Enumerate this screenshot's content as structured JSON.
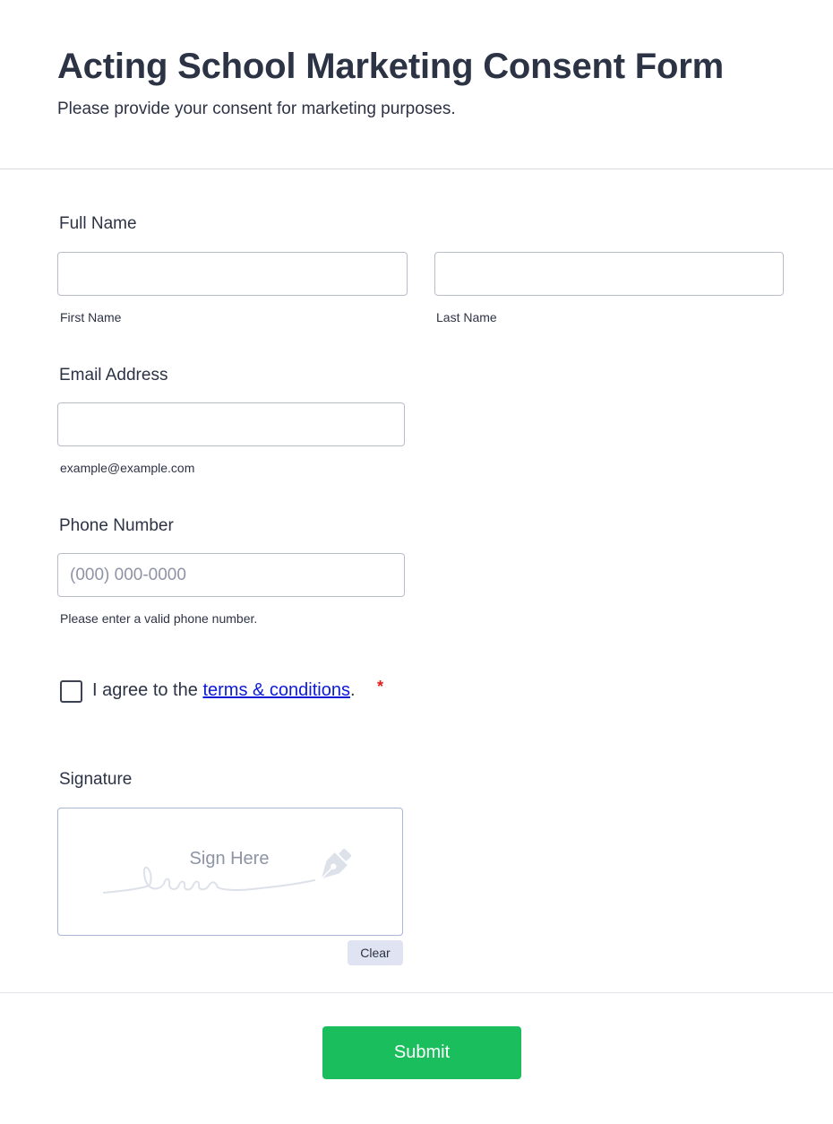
{
  "form": {
    "title": "Acting School Marketing Consent Form",
    "subtitle": "Please provide your consent for marketing purposes."
  },
  "full_name": {
    "label": "Full Name",
    "first": {
      "value": "",
      "sublabel": "First Name"
    },
    "last": {
      "value": "",
      "sublabel": "Last Name"
    }
  },
  "email": {
    "label": "Email Address",
    "value": "",
    "sublabel": "example@example.com"
  },
  "phone": {
    "label": "Phone Number",
    "value": "",
    "placeholder": "(000) 000-0000",
    "sublabel": "Please enter a valid phone number."
  },
  "terms": {
    "prefix": "I agree to the",
    "link_text": "terms & conditions",
    "suffix": ".",
    "required_mark": "*",
    "checked": false
  },
  "signature": {
    "label": "Signature",
    "hint": "Sign Here",
    "clear_label": "Clear"
  },
  "submit": {
    "label": "Submit"
  },
  "colors": {
    "text": "#2c3345",
    "submit": "#1bbe5c",
    "link": "#0b1ad6",
    "required": "#e31b1b",
    "clear_bg": "#dfe3f2"
  }
}
